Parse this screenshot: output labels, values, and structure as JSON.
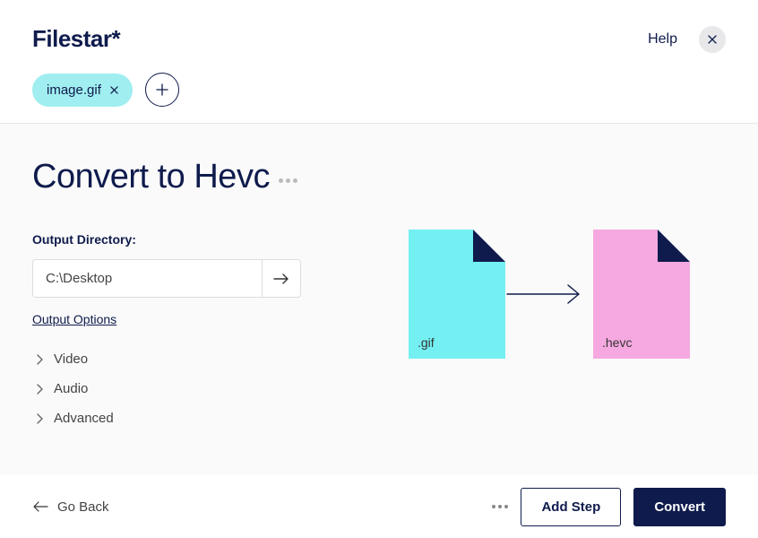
{
  "header": {
    "logo": "Filestar*",
    "help_label": "Help",
    "file_chip": "image.gif"
  },
  "main": {
    "title": "Convert to Hevc",
    "output_label": "Output Directory:",
    "output_value": "C:\\Desktop",
    "options_label": "Output Options",
    "sections": {
      "video": "Video",
      "audio": "Audio",
      "advanced": "Advanced"
    },
    "diagram": {
      "from_ext": ".gif",
      "to_ext": ".hevc"
    }
  },
  "footer": {
    "go_back": "Go Back",
    "add_step": "Add Step",
    "convert": "Convert"
  }
}
